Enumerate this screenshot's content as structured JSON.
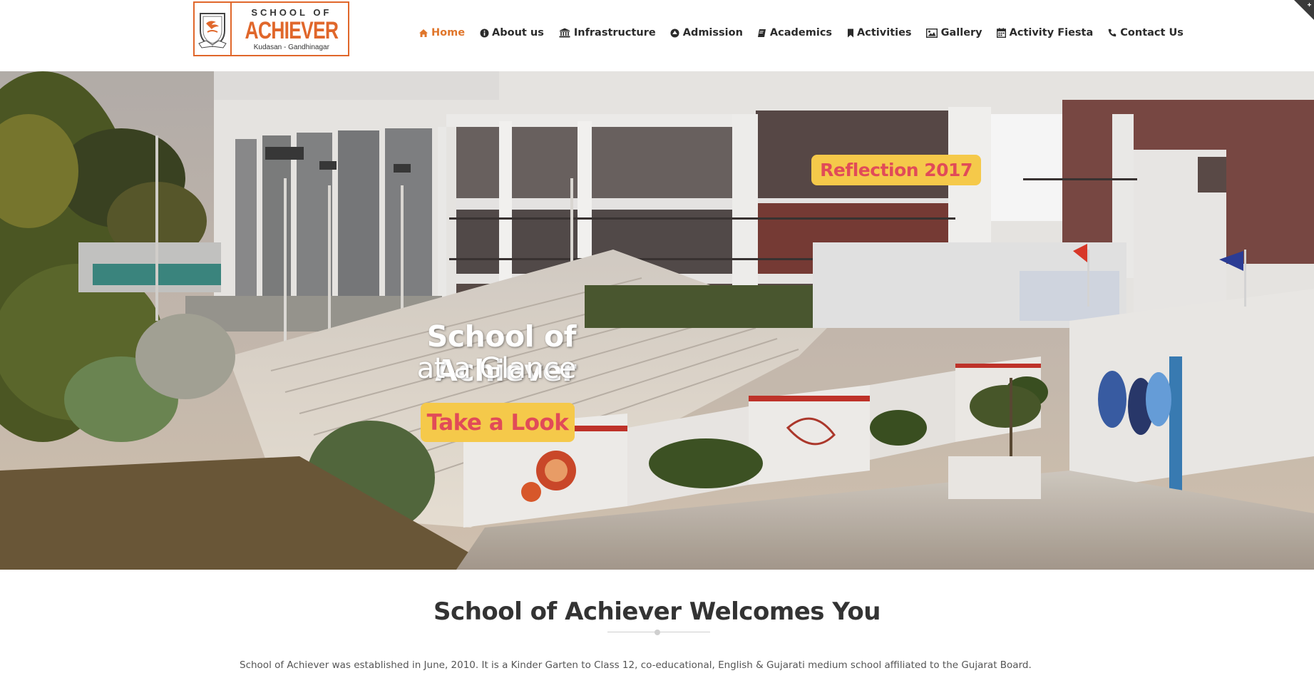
{
  "logo": {
    "line1": "SCHOOL OF",
    "line2": "ACHIEVER",
    "line3": "Kudasan - Gandhinagar",
    "accent": "#e0672b"
  },
  "nav": {
    "items": [
      {
        "label": "Home",
        "icon": "home-icon",
        "active": true
      },
      {
        "label": "About us",
        "icon": "info-circle-icon"
      },
      {
        "label": "Infrastructure",
        "icon": "bank-icon"
      },
      {
        "label": "Admission",
        "icon": "arrow-circle-up-icon"
      },
      {
        "label": "Academics",
        "icon": "book-icon"
      },
      {
        "label": "Activities",
        "icon": "bookmark-icon"
      },
      {
        "label": "Gallery",
        "icon": "image-icon"
      },
      {
        "label": "Activity Fiesta",
        "icon": "calendar-icon"
      },
      {
        "label": "Contact Us",
        "icon": "phone-icon"
      }
    ],
    "active_color": "#e0762b"
  },
  "hero": {
    "title": "School of Achiever",
    "subtitle": "at a Glance",
    "cta_label": "Take a Look",
    "badge_label": "Reflection 2017",
    "button_bg": "#f5c94a",
    "button_text_color": "#e14b58"
  },
  "welcome": {
    "title": "School of Achiever Welcomes You",
    "intro": "School of Achiever was established in June, 2010. It is a Kinder Garten to Class 12, co-educational, English & Gujarati medium school affiliated to the Gujarat Board."
  }
}
